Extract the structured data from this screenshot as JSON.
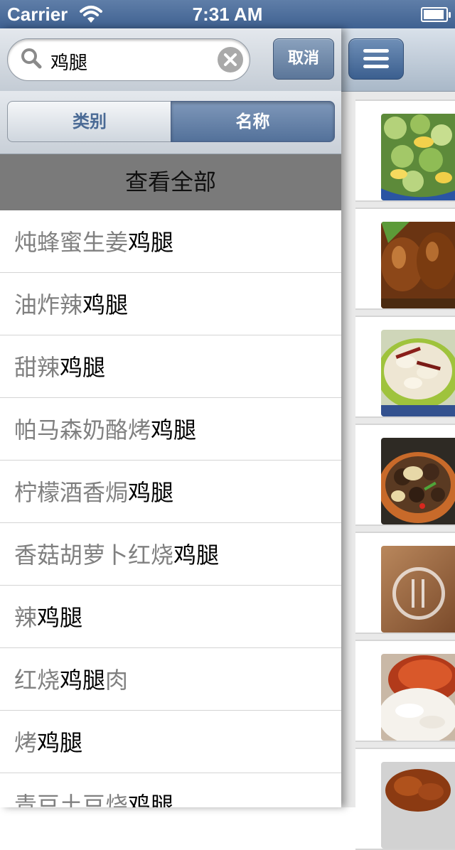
{
  "status_bar": {
    "carrier": "Carrier",
    "time": "7:31 AM"
  },
  "search": {
    "query": "鸡腿",
    "cancel_label": "取消"
  },
  "segments": [
    {
      "label": "类别",
      "selected": false
    },
    {
      "label": "名称",
      "selected": true
    }
  ],
  "view_all_label": "查看全部",
  "results": [
    {
      "pre": "炖蜂蜜生姜",
      "match": "鸡腿",
      "post": ""
    },
    {
      "pre": "油炸辣",
      "match": "鸡腿",
      "post": ""
    },
    {
      "pre": "甜辣",
      "match": "鸡腿",
      "post": ""
    },
    {
      "pre": "帕马森奶酪烤",
      "match": "鸡腿",
      "post": ""
    },
    {
      "pre": "柠檬酒香焗",
      "match": "鸡腿",
      "post": ""
    },
    {
      "pre": "香菇胡萝卜红烧",
      "match": "鸡腿",
      "post": ""
    },
    {
      "pre": "辣",
      "match": "鸡腿",
      "post": ""
    },
    {
      "pre": "红烧",
      "match": "鸡腿",
      "post": "肉"
    },
    {
      "pre": "烤",
      "match": "鸡腿",
      "post": ""
    },
    {
      "pre": "青豆土豆烧",
      "match": "鸡腿",
      "post": ""
    }
  ],
  "colors": {
    "nav_blue": "#3f6191",
    "highlight_text": "#000000",
    "dim_text": "#808080",
    "view_all_bg": "#7a7a7a"
  }
}
